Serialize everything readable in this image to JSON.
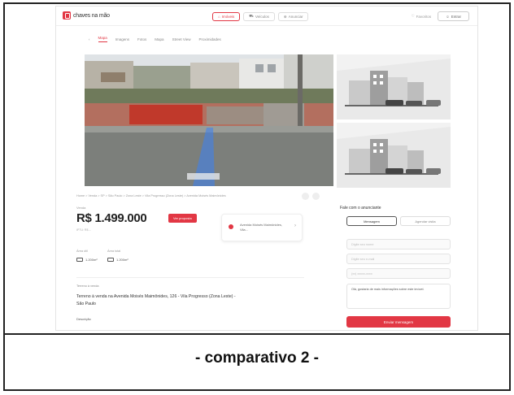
{
  "brand": {
    "name": "chaves na mão",
    "accent": "#e23744"
  },
  "header": {
    "nav": [
      {
        "label": "Imóveis",
        "icon": "home-icon",
        "active": true
      },
      {
        "label": "Veículos",
        "icon": "car-icon",
        "active": false
      },
      {
        "label": "Anunciar",
        "icon": "megaphone-icon",
        "active": false
      }
    ],
    "favorites_label": "Favoritos",
    "login_label": "Entrar"
  },
  "tabs": [
    "Mapa",
    "Imagens",
    "Fotos",
    "Mapa",
    "Street View",
    "Proximidades"
  ],
  "breadcrumb": "Home > Venda > SP > São Paulo > Zona Leste > Vila Progresso (Zona Leste) > Avenida Moisés Maimônides",
  "listing": {
    "price_label": "Venda",
    "price": "R$ 1.499.000",
    "price_sub": "IPTU: R$ --",
    "promo_label": "Ver proposta",
    "location": "Avenida Moisés Maimônides, Vila...",
    "area_total_label": "Área útil",
    "area_total": "1.200m²",
    "area_built_label": "Área total",
    "area_built": "1.200m²",
    "tag": "Terreno à venda",
    "description": "Terreno à venda na Avenida Moisés Maimônides, 126 - Vila Progresso (Zona Leste) - São Paulo",
    "more_label": "Descrição"
  },
  "contact": {
    "title": "Fale com o anunciante",
    "tab_message": "Mensagem",
    "tab_visit": "Agendar visita",
    "name_placeholder": "Digite seu nome",
    "email_placeholder": "Digite seu e-mail",
    "phone_placeholder": "(xx) xxxxx-xxxx",
    "message": "Olá, gostaria de mais informações sobre este imóvel.",
    "send_label": "Enviar mensagem"
  },
  "caption": "- comparativo 2 -"
}
